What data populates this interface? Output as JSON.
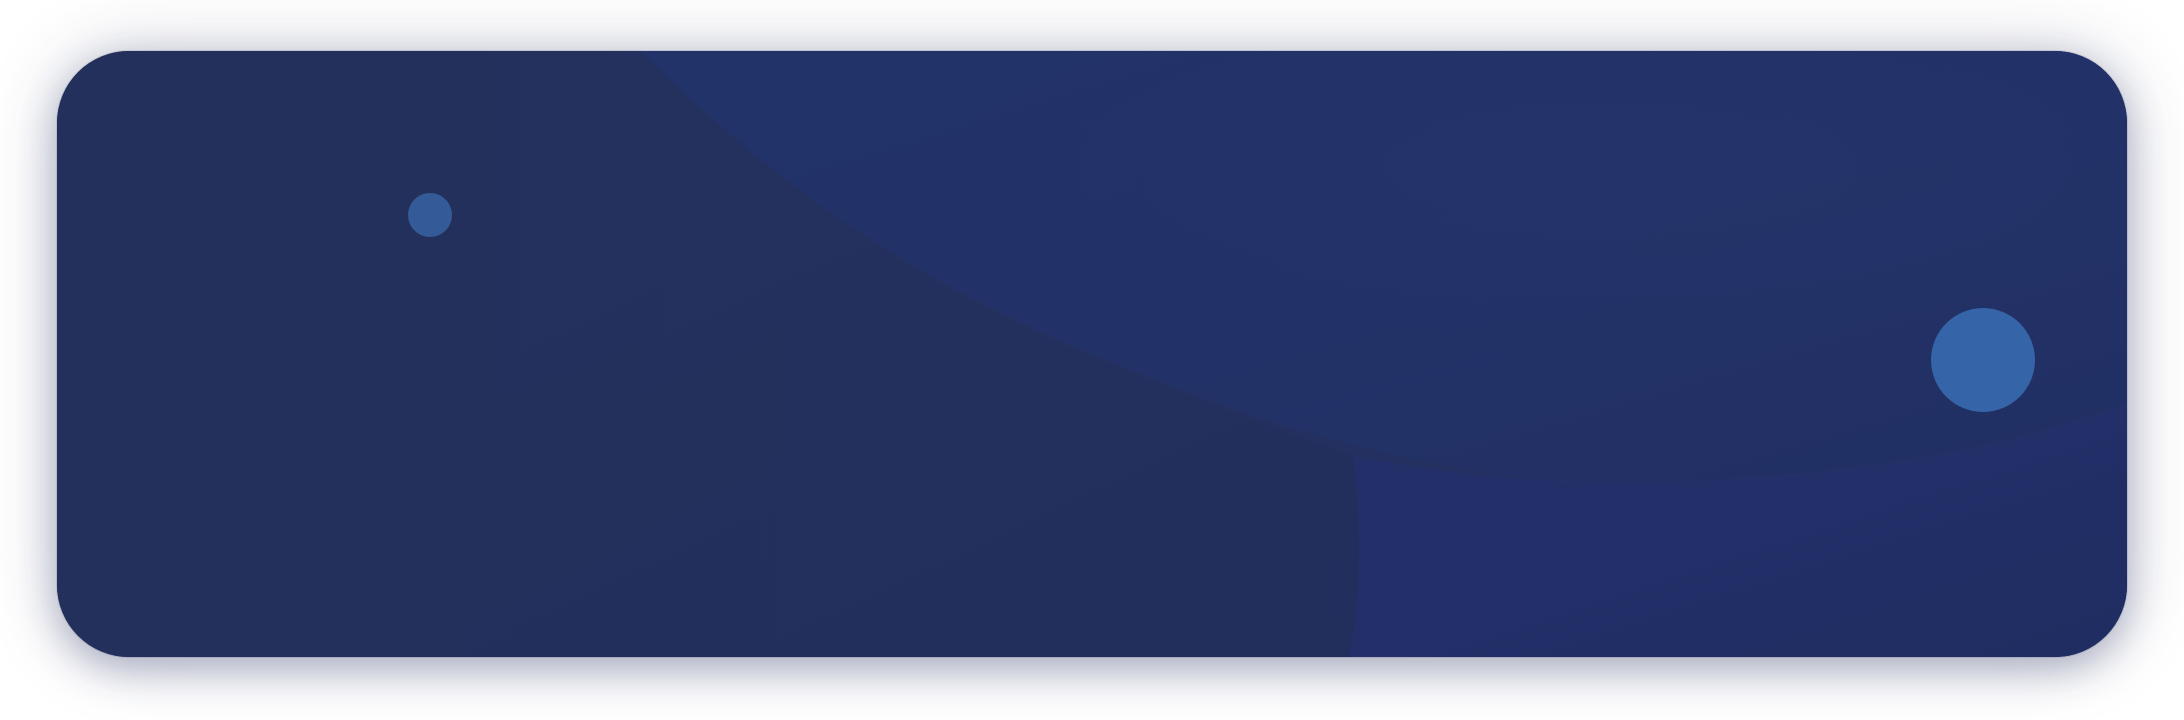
{
  "banner": {
    "style": "dark-navy-abstract-waves",
    "colors": {
      "page_background": "#ffffff",
      "card_background": "#24305b",
      "upper_wave": "#223369",
      "lower_wave": "#222f68",
      "shadow_tint": "#303867",
      "small_dot": "#345b97",
      "large_dot": "#3664a8"
    },
    "decorations": [
      {
        "name": "small-circle",
        "shape": "circle"
      },
      {
        "name": "large-circle",
        "shape": "circle"
      }
    ]
  }
}
